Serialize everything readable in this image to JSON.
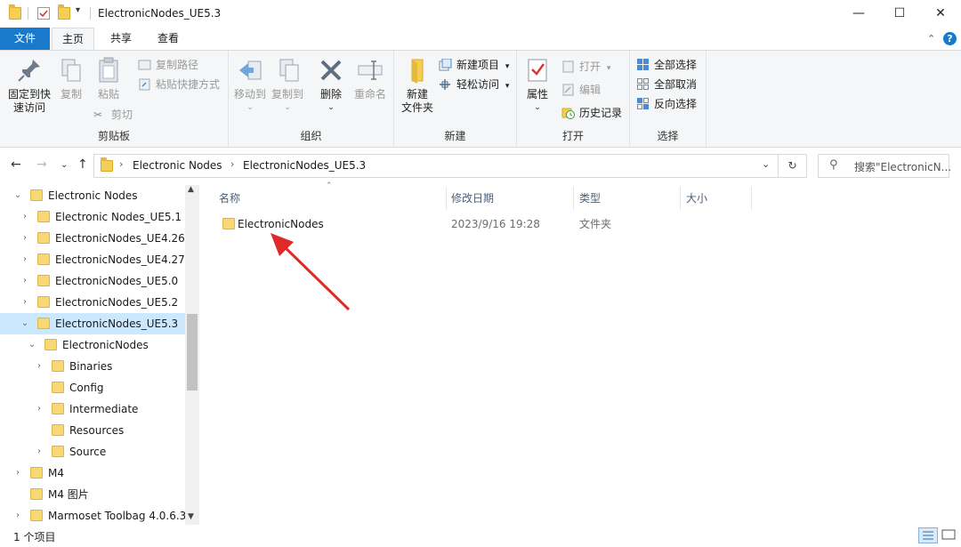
{
  "window": {
    "title": "ElectronicNodes_UE5.3",
    "minimize": "—",
    "maximize": "☐",
    "close": "✕"
  },
  "tabs": {
    "file": "文件",
    "home": "主页",
    "share": "共享",
    "view": "查看"
  },
  "ribbon": {
    "clipboard": {
      "label": "剪贴板",
      "pin_line1": "固定到快",
      "pin_line2": "速访问",
      "copy": "复制",
      "paste": "粘贴",
      "copy_path": "复制路径",
      "paste_shortcut": "粘贴快捷方式",
      "cut": "剪切"
    },
    "organize": {
      "label": "组织",
      "move_to": "移动到",
      "copy_to": "复制到",
      "delete": "删除",
      "rename": "重命名"
    },
    "new": {
      "label": "新建",
      "new_folder_line1": "新建",
      "new_folder_line2": "文件夹",
      "new_item": "新建项目",
      "easy_access": "轻松访问"
    },
    "open": {
      "label": "打开",
      "properties": "属性",
      "open": "打开",
      "edit": "编辑",
      "history": "历史记录"
    },
    "select": {
      "label": "选择",
      "select_all": "全部选择",
      "select_none": "全部取消",
      "invert": "反向选择"
    }
  },
  "address": {
    "crumb1": "Electronic Nodes",
    "crumb2": "ElectronicNodes_UE5.3",
    "search_placeholder": "搜索\"ElectronicN..."
  },
  "tree": [
    {
      "label": "Electronic Nodes",
      "level": 0,
      "chevron": "⌄",
      "selected": false
    },
    {
      "label": "Electronic Nodes_UE5.1",
      "level": 1,
      "chevron": "›",
      "selected": false
    },
    {
      "label": "ElectronicNodes_UE4.26",
      "level": 1,
      "chevron": "›",
      "selected": false
    },
    {
      "label": "ElectronicNodes_UE4.27",
      "level": 1,
      "chevron": "›",
      "selected": false
    },
    {
      "label": "ElectronicNodes_UE5.0",
      "level": 1,
      "chevron": "›",
      "selected": false
    },
    {
      "label": "ElectronicNodes_UE5.2",
      "level": 1,
      "chevron": "›",
      "selected": false
    },
    {
      "label": "ElectronicNodes_UE5.3",
      "level": 1,
      "chevron": "⌄",
      "selected": true
    },
    {
      "label": "ElectronicNodes",
      "level": 2,
      "chevron": "⌄",
      "selected": false
    },
    {
      "label": "Binaries",
      "level": 3,
      "chevron": "›",
      "selected": false
    },
    {
      "label": "Config",
      "level": 3,
      "chevron": "",
      "selected": false
    },
    {
      "label": "Intermediate",
      "level": 3,
      "chevron": "›",
      "selected": false
    },
    {
      "label": "Resources",
      "level": 3,
      "chevron": "",
      "selected": false
    },
    {
      "label": "Source",
      "level": 3,
      "chevron": "›",
      "selected": false
    },
    {
      "label": "M4",
      "level": 0,
      "chevron": "›",
      "selected": false
    },
    {
      "label": "M4 图片",
      "level": 0,
      "chevron": "",
      "selected": false
    },
    {
      "label": "Marmoset Toolbag 4.0.6.3",
      "level": 0,
      "chevron": "›",
      "selected": false
    }
  ],
  "columns": {
    "name": "名称",
    "modified": "修改日期",
    "type": "类型",
    "size": "大小"
  },
  "files": [
    {
      "name": "ElectronicNodes",
      "modified": "2023/9/16 19:28",
      "type": "文件夹",
      "size": ""
    }
  ],
  "status": {
    "count": "1 个项目"
  },
  "colors": {
    "accent": "#1979ca",
    "selection": "#cce8ff",
    "annotation_arrow": "#e02a2a"
  }
}
